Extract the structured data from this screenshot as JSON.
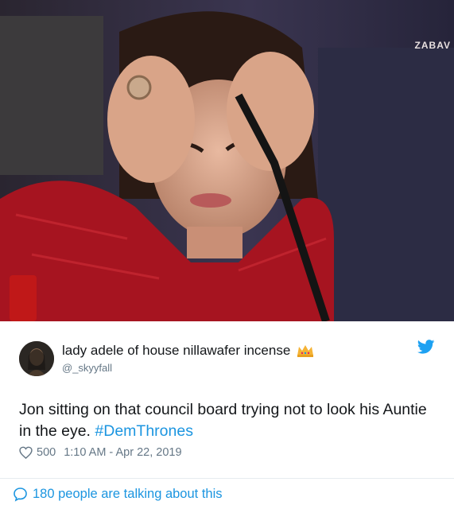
{
  "photo": {
    "watermark": "ZABAV",
    "alt_icon": "meme-photo"
  },
  "author": {
    "display_name": "lady adele of house nillawafer incense",
    "handle": "@_skyyfall",
    "badge_icon": "crown-icon"
  },
  "brand_icon": "twitter-bird-icon",
  "tweet": {
    "text": "Jon sitting on that council board trying not to look his Auntie in the eye.",
    "hashtag": "#DemThrones"
  },
  "meta": {
    "likes": "500",
    "timestamp": "1:10 AM - Apr 22, 2019"
  },
  "footer": {
    "talking": "180 people are talking about this"
  },
  "colors": {
    "accent": "#1b95e0",
    "text": "#14171a",
    "muted": "#657786",
    "divider": "#e6ecf0"
  }
}
